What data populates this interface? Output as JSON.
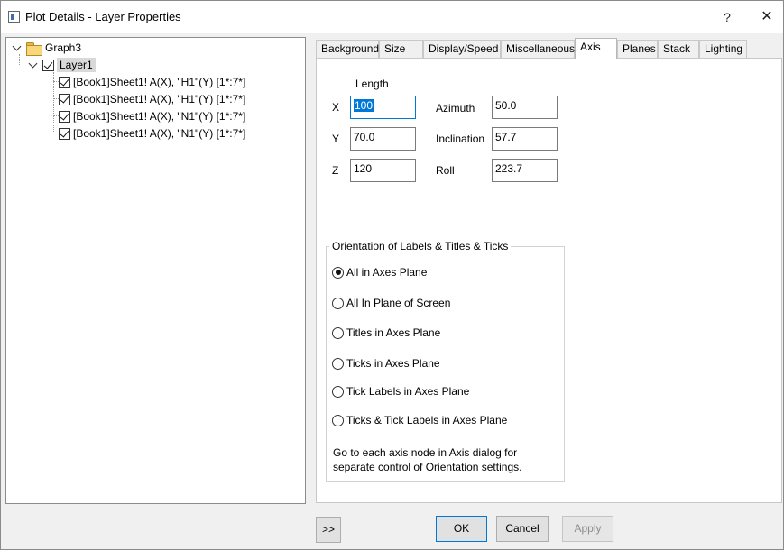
{
  "window": {
    "title": "Plot Details - Layer Properties",
    "help_label": "?",
    "close_label": "✕"
  },
  "tree": {
    "root": {
      "label": "Graph3"
    },
    "layer": {
      "label": "Layer1",
      "checked": true
    },
    "plots": [
      {
        "label": "[Book1]Sheet1! A(X), \"H1\"(Y) [1*:7*]",
        "checked": true
      },
      {
        "label": "[Book1]Sheet1! A(X), \"H1\"(Y) [1*:7*]",
        "checked": true
      },
      {
        "label": "[Book1]Sheet1! A(X), \"N1\"(Y) [1*:7*]",
        "checked": true
      },
      {
        "label": "[Book1]Sheet1! A(X), \"N1\"(Y) [1*:7*]",
        "checked": true
      }
    ]
  },
  "tabs": [
    {
      "label": "Background",
      "active": false
    },
    {
      "label": "Size",
      "active": false
    },
    {
      "label": "Display/Speed",
      "active": false
    },
    {
      "label": "Miscellaneous",
      "active": false
    },
    {
      "label": "Axis",
      "active": true
    },
    {
      "label": "Planes",
      "active": false
    },
    {
      "label": "Stack",
      "active": false
    },
    {
      "label": "Lighting",
      "active": false
    }
  ],
  "axis": {
    "length_header": "Length",
    "x_label": "X",
    "x_value": "100",
    "y_label": "Y",
    "y_value": "70.0",
    "z_label": "Z",
    "z_value": "120",
    "azimuth_label": "Azimuth",
    "azimuth_value": "50.0",
    "inclination_label": "Inclination",
    "inclination_value": "57.7",
    "roll_label": "Roll",
    "roll_value": "223.7"
  },
  "orientation": {
    "title": "Orientation of Labels & Titles & Ticks",
    "options": [
      {
        "label": "All in Axes Plane",
        "selected": true
      },
      {
        "label": "All In Plane of Screen",
        "selected": false
      },
      {
        "label": "Titles in Axes Plane",
        "selected": false
      },
      {
        "label": "Ticks in Axes Plane",
        "selected": false
      },
      {
        "label": "Tick Labels in Axes Plane",
        "selected": false
      },
      {
        "label": "Ticks & Tick Labels in Axes Plane",
        "selected": false
      }
    ],
    "note": "Go to each axis node in Axis dialog for separate control of Orientation settings."
  },
  "buttons": {
    "more": ">>",
    "ok": "OK",
    "cancel": "Cancel",
    "apply": "Apply"
  },
  "colors": {
    "accent": "#0078d7",
    "panel_bg": "#ffffff",
    "window_bg": "#f0f0f0"
  }
}
